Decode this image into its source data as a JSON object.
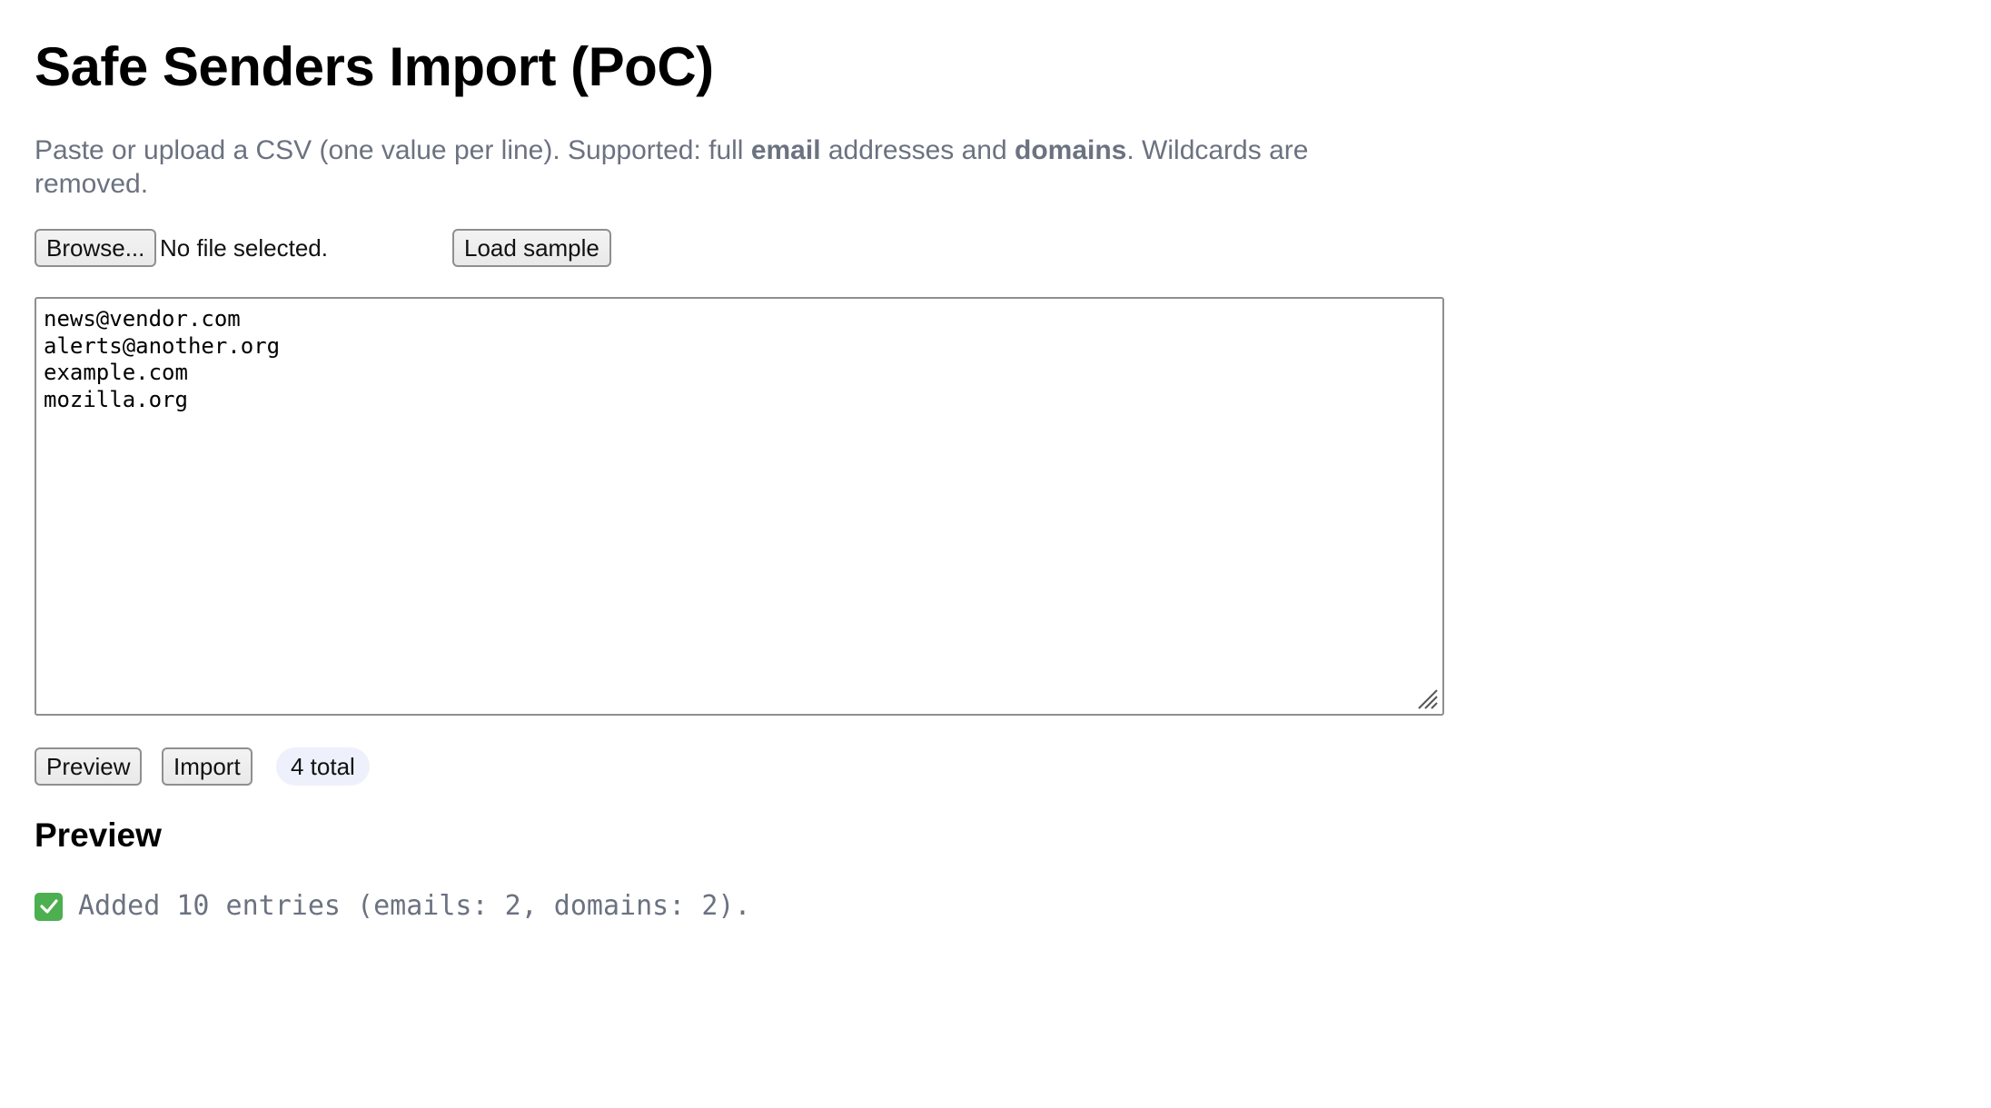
{
  "header": {
    "title": "Safe Senders Import (PoC)"
  },
  "description": {
    "part1": "Paste or upload a CSV (one value per line). Supported: full ",
    "email_word": "email",
    "part2": " addresses and ",
    "domains_word": "domains",
    "part3": ". Wildcards are removed."
  },
  "file_picker": {
    "browse_label": "Browse...",
    "status": "No file selected."
  },
  "load_sample_label": "Load sample",
  "csv_input": {
    "value": "news@vendor.com\nalerts@another.org\nexample.com\nmozilla.org"
  },
  "actions": {
    "preview_label": "Preview",
    "import_label": "Import",
    "count_badge": "4 total"
  },
  "preview_section": {
    "title": "Preview",
    "result_icon": "check-mark-icon",
    "result_text": "Added 10 entries (emails: 2, domains: 2)."
  },
  "colors": {
    "muted_text": "#6b7280",
    "success_icon": "#4caf50",
    "badge_bg": "#eef1fb"
  }
}
